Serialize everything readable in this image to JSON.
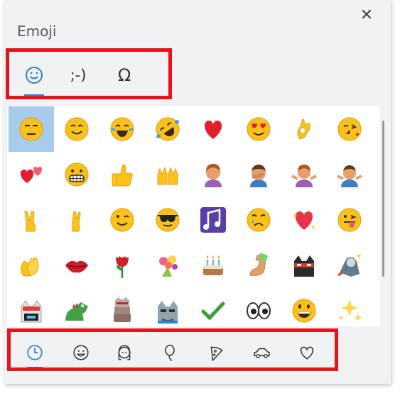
{
  "panel": {
    "title": "Emoji",
    "close_label": "✕"
  },
  "top_tabs": [
    {
      "name": "tab-emoji",
      "label": "☺",
      "active": true
    },
    {
      "name": "tab-kaomoji",
      "label": ";-)",
      "active": false
    },
    {
      "name": "tab-symbols",
      "label": "Ω",
      "active": false
    }
  ],
  "emoji_grid": [
    [
      "unamused-face",
      "smiling-face",
      "tears-of-joy-face",
      "rolling-laughing-face",
      "red-heart",
      "heart-eyes-face",
      "ok-hand",
      "kissing-heart-face"
    ],
    [
      "two-hearts",
      "grinning-face",
      "thumbs-up",
      "raised-hands",
      "woman-facepalming",
      "man-facepalming",
      "woman-shrugging",
      "man-shrugging"
    ],
    [
      "victory-hand",
      "crossed-fingers",
      "winking-face",
      "sunglasses-face",
      "musical-notes",
      "crying-face",
      "sparkling-heart",
      "winking-tongue-face"
    ],
    [
      "clapping-hands",
      "kiss-mark",
      "rose",
      "bouquet",
      "birthday-cake",
      "flexed-biceps",
      "ninja-cat",
      "astronaut-cat"
    ],
    [
      "hacker-cat",
      "dino-cat",
      "stack-cat",
      "hipster-cat",
      "check-mark",
      "eyes",
      "grinning-face-big",
      "sparkles"
    ]
  ],
  "bottom_tabs": [
    {
      "name": "tab-recent",
      "icon": "clock-icon",
      "active": true
    },
    {
      "name": "tab-smileys",
      "icon": "smiley-icon",
      "active": false
    },
    {
      "name": "tab-people",
      "icon": "person-icon",
      "active": false
    },
    {
      "name": "tab-celebration",
      "icon": "balloon-icon",
      "active": false
    },
    {
      "name": "tab-food",
      "icon": "pizza-icon",
      "active": false
    },
    {
      "name": "tab-transport",
      "icon": "car-icon",
      "active": false
    },
    {
      "name": "tab-symbols-hearts",
      "icon": "heart-icon",
      "active": false
    }
  ],
  "colors": {
    "accent": "#2f82cd",
    "highlight": "#e8121a",
    "selected_cell": "#a6cbeb"
  }
}
